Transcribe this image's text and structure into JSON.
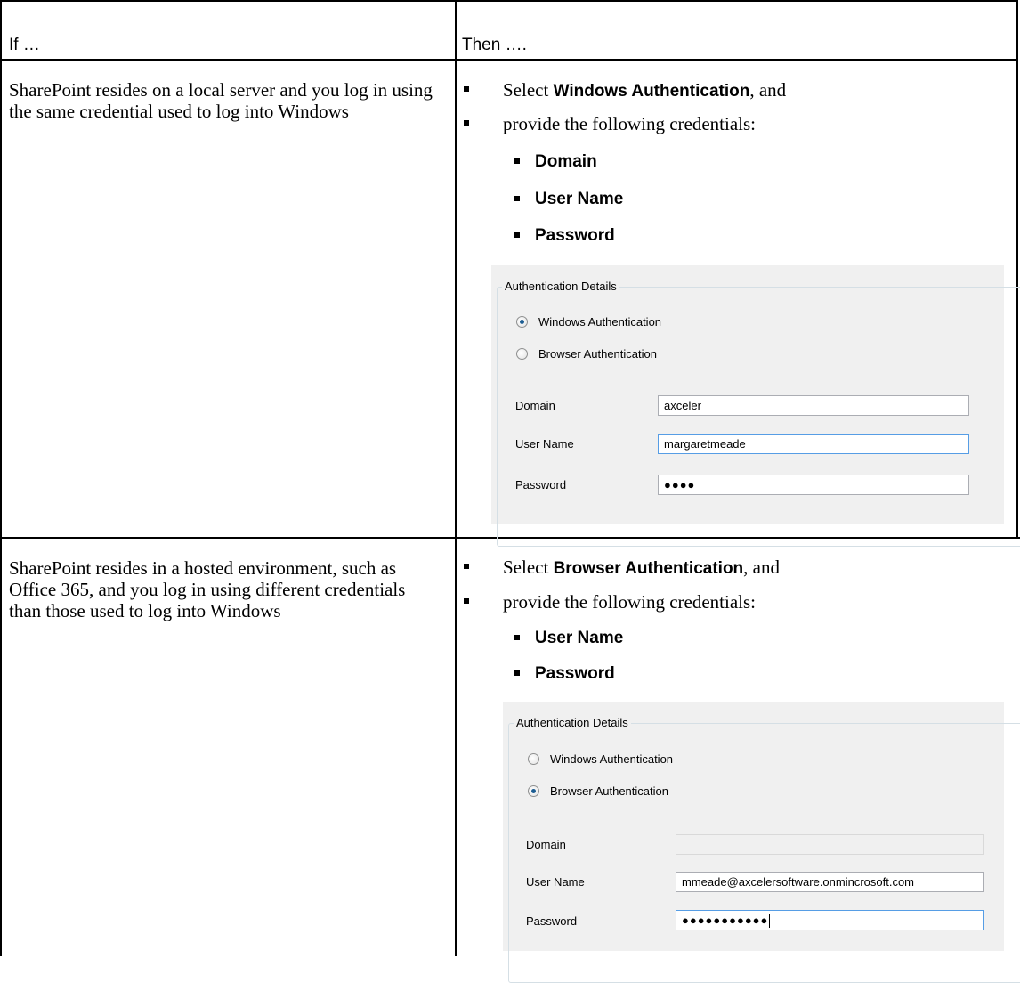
{
  "table": {
    "header": {
      "if": "If …",
      "then": "Then …."
    },
    "rows": [
      {
        "condition": "SharePoint resides on a local server and you log in using the same credential used to log into Windows",
        "step1_prefix": "Select ",
        "step1_bold": "Windows Authentication",
        "step1_suffix": ", and",
        "step2": "provide the following credentials:",
        "credentials": [
          "Domain",
          "User Name",
          "Password"
        ],
        "panel": {
          "group_title": "Authentication Details",
          "radio_windows": "Windows Authentication",
          "radio_browser": "Browser Authentication",
          "selected": "Windows Authentication",
          "domain_label": "Domain",
          "domain_value": "axceler",
          "username_label": "User Name",
          "username_value": "margaretmeade",
          "password_label": "Password",
          "password_value": "●●●●"
        }
      },
      {
        "condition": "SharePoint resides in a hosted environment, such as Office 365, and you log in using different credentials than those used to log into Windows",
        "step1_prefix": "Select ",
        "step1_bold": "Browser Authentication",
        "step1_suffix": ", and",
        "step2": "provide the following credentials:",
        "credentials": [
          "User Name",
          "Password"
        ],
        "panel": {
          "group_title": "Authentication Details",
          "radio_windows": "Windows Authentication",
          "radio_browser": "Browser Authentication",
          "selected": "Browser Authentication",
          "domain_label": "Domain",
          "domain_value": "",
          "username_label": "User Name",
          "username_value": "mmeade@axcelersoftware.onmincrosoft.com",
          "password_label": "Password",
          "password_value": "●●●●●●●●●●●"
        }
      }
    ]
  }
}
